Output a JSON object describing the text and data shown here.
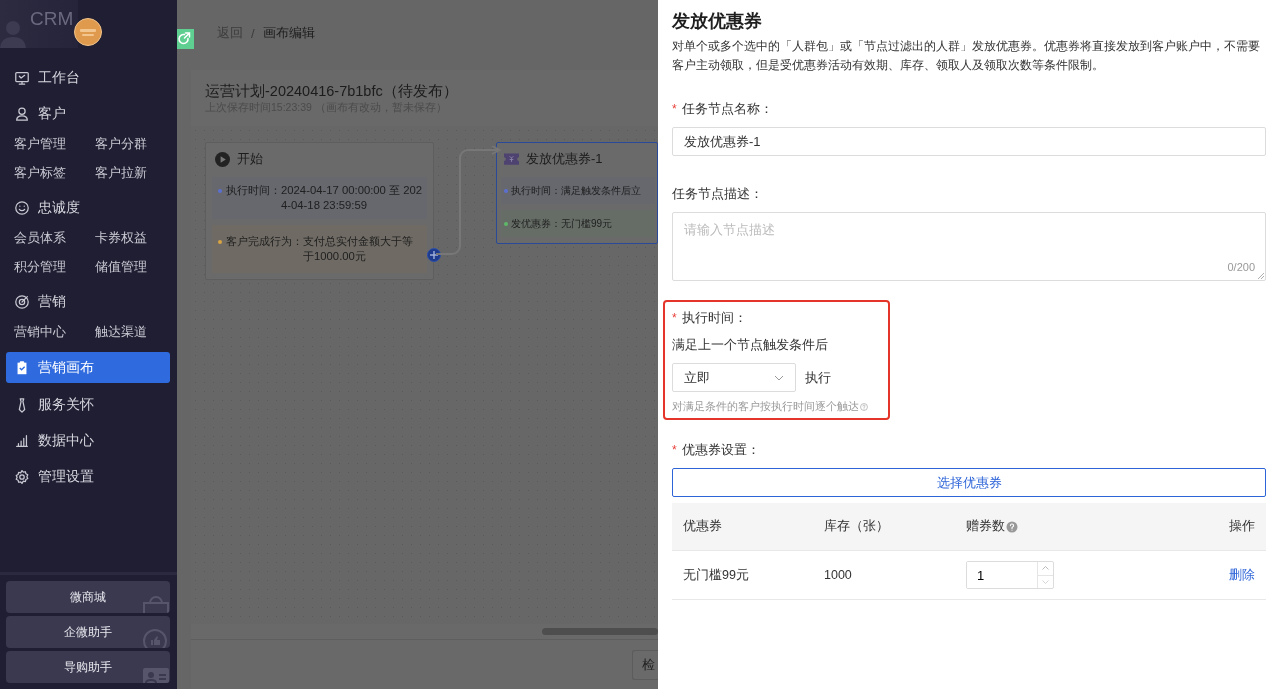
{
  "sidebar": {
    "brand": "CRM",
    "menu": [
      {
        "label": "工作台",
        "selected": false
      },
      {
        "label": "客户",
        "selected": false,
        "sub_items": [
          "客户管理",
          "客户分群",
          "客户标签",
          "客户拉新"
        ]
      },
      {
        "label": "忠诚度",
        "selected": false,
        "sub_items": [
          "会员体系",
          "卡券权益",
          "积分管理",
          "储值管理"
        ]
      },
      {
        "label": "营销",
        "selected": false,
        "sub_items": [
          "营销中心",
          "触达渠道"
        ]
      },
      {
        "label": "营销画布",
        "selected": true
      },
      {
        "label": "服务关怀",
        "selected": false
      },
      {
        "label": "数据中心",
        "selected": false
      },
      {
        "label": "管理设置",
        "selected": false
      }
    ],
    "shortcuts": [
      "微商城",
      "企微助手",
      "导购助手"
    ]
  },
  "breadcrumb": {
    "back": "返回",
    "separator": "/",
    "current": "画布编辑"
  },
  "plan": {
    "title": "运营计划-20240416-7b1bfc（待发布）",
    "saved_note": "上次保存时间15:23:39 （画布有改动，暂未保存）"
  },
  "nodes": [
    {
      "kind": "start",
      "title": "开始",
      "selected": false,
      "rows": [
        {
          "label": "执行时间：",
          "value": "2024-04-17 00:00:00 至 2024-04-18 23:59:59",
          "color": "#5c6fd0"
        },
        {
          "label": "客户完成行为：",
          "value": "支付总实付金额大于等于1000.00元",
          "color": "#d9a441"
        }
      ]
    },
    {
      "kind": "coupon",
      "title": "发放优惠券-1",
      "selected": true,
      "rows": [
        {
          "label": "执行时间：",
          "value": "满足触发条件后立",
          "color": "#5c6fd0"
        },
        {
          "label": "发优惠券：",
          "value": "无门槛99元",
          "color": "#5fb86a"
        }
      ]
    }
  ],
  "footer": {
    "button": "检"
  },
  "drawer": {
    "title": "发放优惠券",
    "description": "对单个或多个选中的「人群包」或「节点过滤出的人群」发放优惠券。优惠券将直接发放到客户账户中，不需要客户主动领取，但是受优惠券活动有效期、库存、领取人及领取次数等条件限制。",
    "fields": [
      {
        "kind": "input",
        "required_mark": "*",
        "label": "任务节点名称：",
        "value": "发放优惠券-1"
      },
      {
        "kind": "textarea",
        "label": "任务节点描述：",
        "placeholder": "请输入节点描述",
        "counter": "0/200"
      },
      {
        "kind": "timing",
        "required_mark": "*",
        "label": "执行时间：",
        "highlighted": true,
        "text": "满足上一个节点触发条件后",
        "select": "立即",
        "suffix": "执行",
        "hint": "对满足条件的客户按执行时间逐个触达"
      },
      {
        "kind": "coupons",
        "required_mark": "*",
        "label": "优惠券设置：",
        "button": "选择优惠券",
        "columns": [
          {
            "label": "优惠券"
          },
          {
            "label": "库存（张）"
          },
          {
            "label": "赠券数",
            "help": true
          },
          {
            "label": "操作"
          }
        ],
        "rows": [
          {
            "coupon": "无门槛99元",
            "stock": "1000",
            "quantity": "1",
            "action": "删除"
          }
        ]
      }
    ]
  }
}
